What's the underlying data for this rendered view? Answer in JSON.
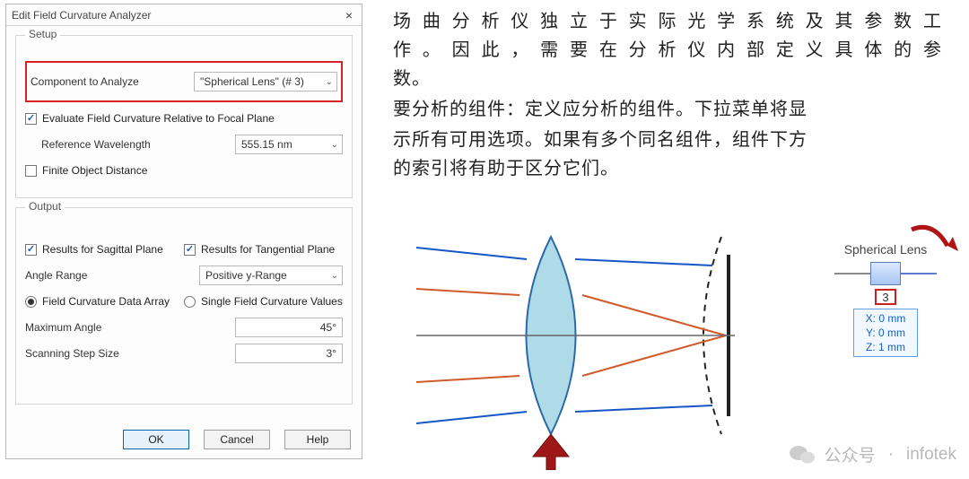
{
  "dialog": {
    "title": "Edit Field Curvature Analyzer",
    "close": "×",
    "setup": {
      "heading": "Setup",
      "component_label": "Component to Analyze",
      "component_value": "\"Spherical Lens\" (# 3)",
      "evalplane_label": "Evaluate Field Curvature Relative to Focal Plane",
      "refwl_label": "Reference Wavelength",
      "refwl_value": "555.15 nm",
      "finite_label": "Finite Object Distance"
    },
    "output": {
      "heading": "Output",
      "sag_label": "Results for Sagittal Plane",
      "tan_label": "Results for Tangential Plane",
      "angle_label": "Angle Range",
      "angle_value": "Positive y-Range",
      "dataarray_label": "Field Curvature Data Array",
      "singlevals_label": "Single Field Curvature Values",
      "maxangle_label": "Maximum Angle",
      "maxangle_value": "45°",
      "step_label": "Scanning Step Size",
      "step_value": "3°"
    },
    "buttons": {
      "ok": "OK",
      "cancel": "Cancel",
      "help": "Help"
    }
  },
  "text": {
    "p1a": "场曲分析仪独立于实际光学系统及其参数工",
    "p1b": "作。因此，需要在分析仪内部定义具体的参",
    "p1c": "数。",
    "p2a": "要分析的组件：定义应分析的组件。下拉菜单将显",
    "p2b": "示所有可用选项。如果有多个同名组件，组件下方",
    "p2c": "的索引将有助于区分它们。"
  },
  "node": {
    "title": "Spherical Lens",
    "index": "3",
    "x": "X: 0 mm",
    "y": "Y: 0 mm",
    "z": "Z: 1 mm"
  },
  "watermark": {
    "label": "公众号",
    "sep": "·",
    "name": "infotek"
  }
}
